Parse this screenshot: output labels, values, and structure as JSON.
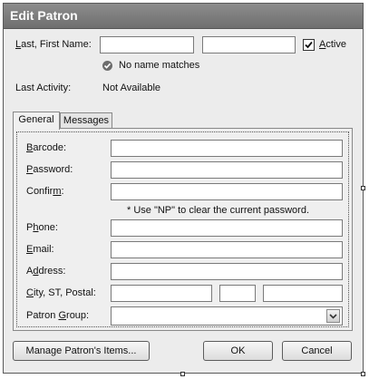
{
  "window": {
    "title": "Edit Patron"
  },
  "name": {
    "label": "Last, First Name:",
    "last_value": "",
    "first_value": "",
    "active_label": "Active",
    "active_checked": true
  },
  "match": {
    "text": "No name matches"
  },
  "activity": {
    "label": "Last Activity:",
    "value": "Not Available"
  },
  "tabs": [
    {
      "label": "General",
      "active": true
    },
    {
      "label": "Messages",
      "active": false
    }
  ],
  "form": {
    "barcode_label": "Barcode:",
    "password_label": "Password:",
    "confirm_label": "Confirm:",
    "password_note": "* Use \"NP\" to clear the current password.",
    "phone_label": "Phone:",
    "email_label": "Email:",
    "address_label": "Address:",
    "city_label": "City, ST, Postal:",
    "group_label": "Patron Group:",
    "group_selected": ""
  },
  "buttons": {
    "manage": "Manage Patron's Items...",
    "ok": "OK",
    "cancel": "Cancel"
  },
  "icons": {
    "checkmark": "check-icon",
    "status": "circle-check-icon",
    "dropdown": "chevron-down-icon"
  }
}
